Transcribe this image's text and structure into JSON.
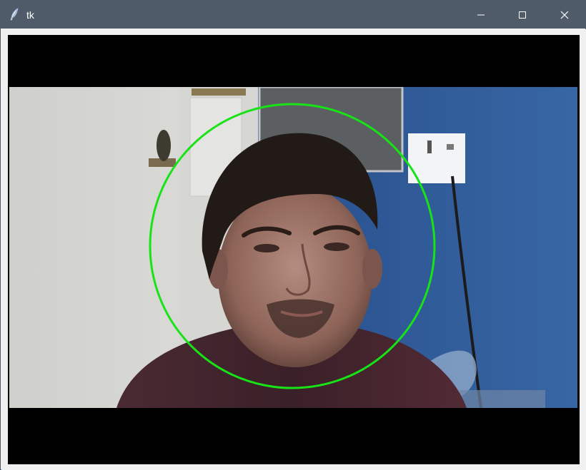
{
  "window": {
    "title": "tk",
    "icon": "feather-icon",
    "controls": [
      "minimize-icon",
      "maximize-icon",
      "close-icon"
    ]
  },
  "video": {
    "detection_shape": "circle",
    "detection_color": "#17e317"
  },
  "colors": {
    "titlebar": "#4f5b69",
    "client_bg": "#f0f0f0",
    "canvas_bg": "#000000",
    "wall_left": "#dcdcd8",
    "wall_right": "#2f5c9a"
  }
}
